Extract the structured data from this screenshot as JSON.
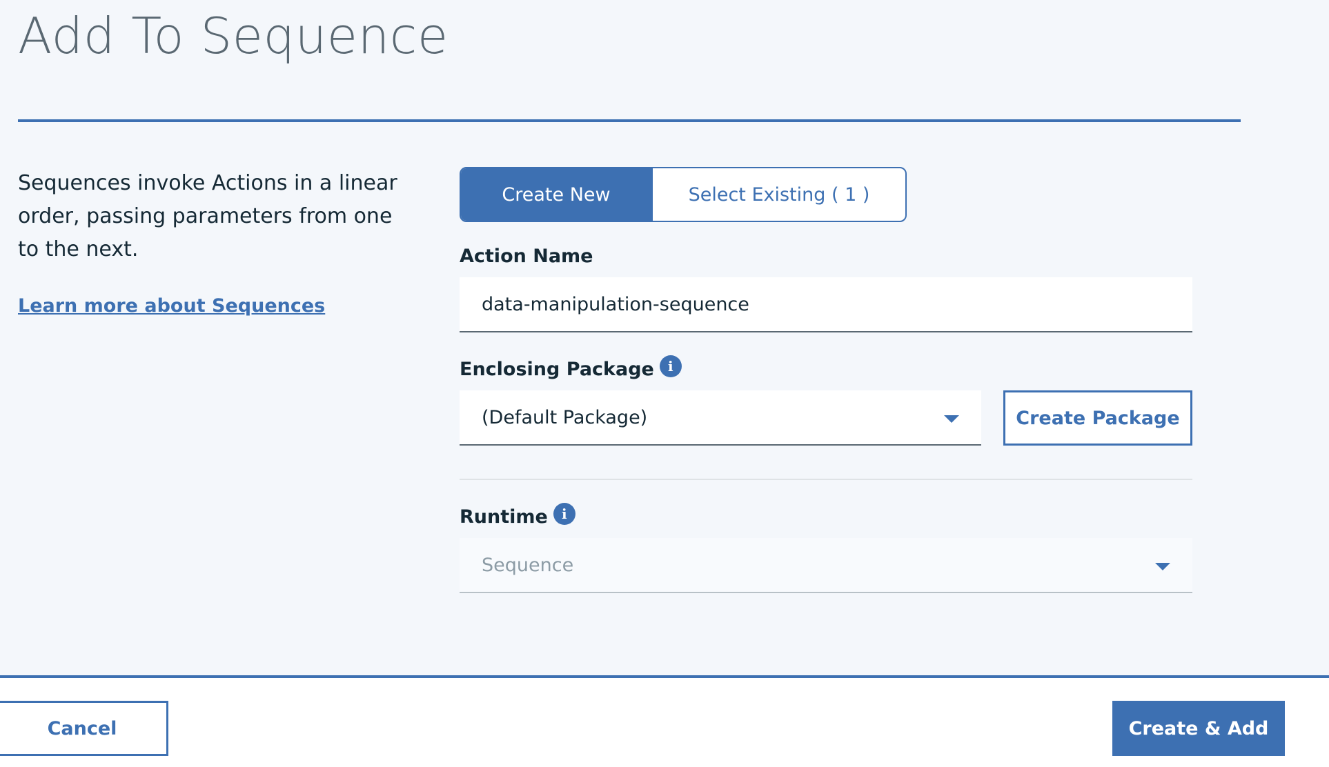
{
  "dialog": {
    "title": "Add To Sequence",
    "description": "Sequences invoke Actions in a linear order, passing parameters from one to the next.",
    "learn_more_link": "Learn more about Sequences"
  },
  "mode_toggle": {
    "options": [
      {
        "label": "Create New",
        "selected": true
      },
      {
        "label": "Select Existing ( 1 )",
        "selected": false
      }
    ]
  },
  "form": {
    "action_name": {
      "label": "Action Name",
      "value": "data-manipulation-sequence"
    },
    "enclosing_package": {
      "label": "Enclosing Package",
      "info_icon": "info-icon",
      "value": "(Default Package)",
      "create_button": "Create Package"
    },
    "runtime": {
      "label": "Runtime",
      "info_icon": "info-icon",
      "value": "Sequence",
      "disabled": true
    }
  },
  "footer": {
    "cancel_label": "Cancel",
    "primary_label": "Create & Add"
  },
  "colors": {
    "accent": "#3d70b2",
    "background": "#f4f7fb",
    "text": "#152935",
    "muted_title": "#5a6872"
  }
}
